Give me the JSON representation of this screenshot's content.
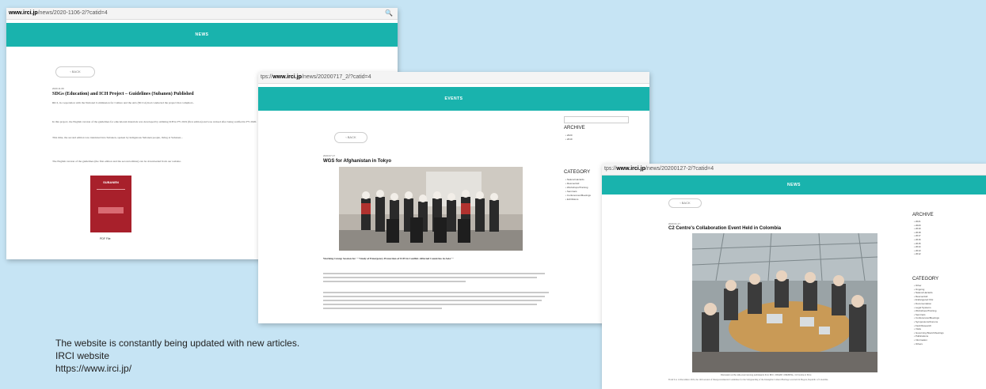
{
  "shot1": {
    "url_host": "www.irci.jp",
    "url_prefix": "",
    "url_path": "/news/2020-1106-2/?catid=4",
    "banner": "NEWS",
    "back_label": "BACK",
    "date": "2020.11.06",
    "title": "SDGs (Education) and ICH Project – Guidelines (Subanen) Published",
    "p1": "IRCI, in cooperation with the National Commission for Culture and the Arts (NCCA) had conducted the project that compiled...",
    "p2": "In this project, the English version of the guidelines for educational materials was developed by utilizing ICH in FY 2019 (first edition) and was revised after being verified in FY 2020.",
    "p3": "This time, the second edition was translated into Subanen, spoken by indigenous Subanen people, living at Subanen...",
    "p4": "The English version of the guidelines (the first edition and the second edition) can be downloaded from our website.",
    "book_title": "SUBANEN",
    "pdf_label": "PDF File"
  },
  "shot2": {
    "url_prefix": "tps://",
    "url_host": "www.irci.jp",
    "url_path": "/news/20200717_2/?catid=4",
    "banner": "EVENTS",
    "back_label": "BACK",
    "date": "2020.07.17",
    "title": "WGS for Afghanistan in Tokyo",
    "subtitle": "Working Group Session for \"\"Study of Emergency Protection of ICH in Conflict-Affected Countries in Asia\"\"",
    "archive_heading": "ARCHIVE",
    "archive_items": [
      "2020",
      "2019"
    ],
    "category_heading": "CATEGORY",
    "category_items": [
      "Natural Hazards",
      "Rescue/Aid",
      "Workshops/Training",
      "Seminars",
      "Conferences/Meetings",
      "Exhibitions"
    ]
  },
  "shot3": {
    "url_prefix": "tps://",
    "url_host": "www.irci.jp",
    "url_path": "/news/20200127-2/?catid=4",
    "banner": "NEWS",
    "back_label": "BACK",
    "date": "2020.01.27",
    "title": "C2 Centre's Collaboration Event Held in Colombia",
    "photo_caption": "Discussion at the side-event among participants from IRCI, CRIHAP, CRESPIAL, C2 Centre in Peru",
    "body": "From 9 to 14 December 2019, the 14th session of Intergovernmental Committee for the Safeguarding of the Intangible Cultural Heritage was held in Bogota, Republic of Colombia.",
    "archive_heading": "ARCHIVE",
    "archive_items": [
      "2021",
      "2020",
      "2019",
      "2018",
      "2017",
      "2016",
      "2015",
      "2014",
      "2013",
      "2012"
    ],
    "category_heading": "CATEGORY",
    "category_items": [
      "Other",
      "Ongoing",
      "Natural Hazards",
      "Rescue/Aid",
      "Endangered ICH",
      "Documentation",
      "Legal Systems",
      "Workshops/Training",
      "Seminars",
      "Conferences/Meetings",
      "Symposiums/Forums",
      "Field Research",
      "Visits",
      "Governing Board Meetings",
      "Publications",
      "Information",
      "Others"
    ]
  },
  "caption": {
    "line1": "The website is constantly being updated with new articles.",
    "line2": "IRCI website",
    "line3": "https://www.irci.jp/"
  }
}
